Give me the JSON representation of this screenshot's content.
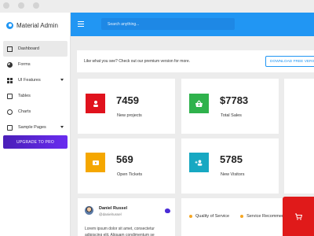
{
  "app": {
    "title": "Material Admin"
  },
  "colors": {
    "brand": "#2196f3",
    "projects": "#e0121d",
    "sales": "#2fb24c",
    "tickets": "#f5a700",
    "visitors": "#17a8c2",
    "upgrade": "#5626d8",
    "legend_dot": "#f5a623"
  },
  "sidebar": {
    "items": [
      {
        "label": "Dashboard",
        "icon": "monitor-icon",
        "active": true
      },
      {
        "label": "Forms",
        "icon": "pie-chart-icon"
      },
      {
        "label": "UI Features",
        "icon": "grid-icon",
        "has_submenu": true
      },
      {
        "label": "Tables",
        "icon": "table-icon"
      },
      {
        "label": "Charts",
        "icon": "help-icon"
      },
      {
        "label": "Sample Pages",
        "icon": "pages-icon",
        "has_submenu": true
      }
    ],
    "upgrade_label": "UPGRADE TO PRO"
  },
  "header": {
    "search_placeholder": "Search anything..."
  },
  "banner": {
    "text": "Like what you see? Check out our premium version for more.",
    "button_label": "DOWNLOAD FREE VERSION"
  },
  "stats": [
    {
      "value": "7459",
      "label": "New projects",
      "icon": "user-icon"
    },
    {
      "value": "$7783",
      "label": "Total Sales",
      "icon": "basket-icon"
    },
    {
      "value": "569",
      "label": "Open Tickets",
      "icon": "ticket-icon"
    },
    {
      "value": "5785",
      "label": "New Visitors",
      "icon": "add-user-icon"
    }
  ],
  "tweet": {
    "name": "Daniel Russel",
    "handle": "@danielrussel",
    "text": "Lorem ipsum dolor sit amet, consectetur adipiscing elit. Aliquam condimentum se"
  },
  "chart": {
    "legend": [
      "Quality of Service",
      "Service Recommendation"
    ]
  }
}
